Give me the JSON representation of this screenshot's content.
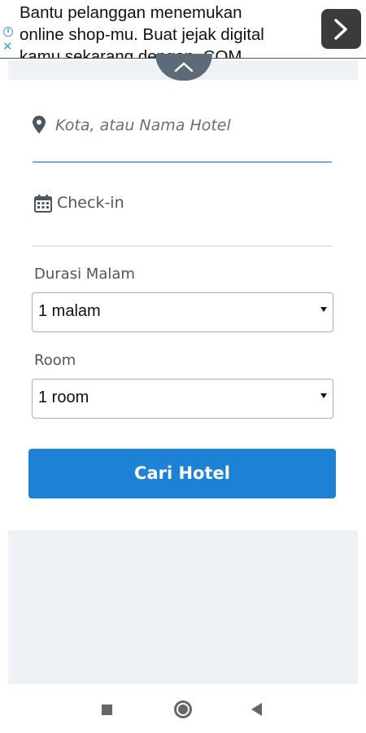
{
  "ad": {
    "lines": [
      "Bantu pelanggan menemukan",
      "online shop-mu. Buat jejak digital",
      "kamu sekarang dengan .COM"
    ],
    "info_icon": "info-icon",
    "close_icon": "close-icon",
    "arrow_icon": "chevron-right-icon"
  },
  "form": {
    "location_placeholder": "Kota, atau Nama Hotel",
    "checkin_label": "Check-in",
    "duration_label": "Durasi Malam",
    "duration_value": "1 malam",
    "room_label": "Room",
    "room_value": "1 room",
    "search_button": "Cari Hotel"
  },
  "colors": {
    "primary": "#1d81d6",
    "underline_active": "#7aa8d8",
    "panel_bg": "#eef2f6"
  }
}
